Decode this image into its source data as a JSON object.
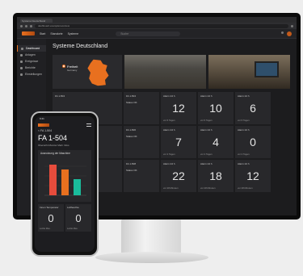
{
  "browser": {
    "tab_title": "Systeme Deutschland",
    "address": "dashboard.example/overview"
  },
  "appbar": {
    "links": [
      "Start",
      "Standorte",
      "Systeme"
    ],
    "search_placeholder": "Suche"
  },
  "sidebar": {
    "items": [
      {
        "label": "Dashboard",
        "active": true
      },
      {
        "label": "Anlagen",
        "active": false
      },
      {
        "label": "Ereignisse",
        "active": false
      },
      {
        "label": "Berichte",
        "active": false
      },
      {
        "label": "Einstellungen",
        "active": false
      }
    ]
  },
  "main": {
    "title": "Systeme Deutschland",
    "map": {
      "location": "Freiheit",
      "region": "Germany"
    }
  },
  "grid": {
    "rows": [
      {
        "left_label": "FA 1-504",
        "info": {
          "head": "FA 1-504",
          "line1": "Status OK"
        },
        "tiles": [
          {
            "head": "Alarm 24 h",
            "value": "12",
            "foot": "vor 6 Tagen"
          },
          {
            "head": "Alarm 24 h",
            "value": "10",
            "foot": "vor 6 Tagen"
          },
          {
            "head": "Alarm 24 h",
            "value": "6",
            "foot": "vor 6 Tagen"
          }
        ]
      },
      {
        "left_label": "FA 1-506",
        "info": {
          "head": "FA 1-506",
          "line1": "Status OK"
        },
        "tiles": [
          {
            "head": "Alarm 24 h",
            "value": "7",
            "foot": "vor 2 Tagen"
          },
          {
            "head": "Alarm 24 h",
            "value": "4",
            "foot": "vor 2 Tagen"
          },
          {
            "head": "Alarm 24 h",
            "value": "0",
            "foot": "vor 2 Tagen"
          }
        ]
      },
      {
        "left_label": "FA 1-508",
        "info": {
          "head": "FA 1-508",
          "line1": "Status OK"
        },
        "tiles": [
          {
            "head": "Alarm 24 h",
            "value": "22",
            "foot": "vor 28 Minuten"
          },
          {
            "head": "Alarm 24 h",
            "value": "18",
            "foot": "vor 28 Minuten"
          },
          {
            "head": "Alarm 24 h",
            "value": "12",
            "foot": "vor 28 Minuten"
          }
        ]
      }
    ]
  },
  "phone": {
    "status_time": "9:41",
    "back_label": "< FA 1-504",
    "title": "FA 1-504",
    "meta": "Übersicht  Monitor  Mehr Infos",
    "chart_title": "Ausnutzung der Maschine",
    "tiles": [
      {
        "head": "Innen Temperatur",
        "value": "0",
        "foot": "Letzte Mes."
      },
      {
        "head": "Luftfeuchte",
        "value": "0",
        "foot": "Letzte Mes."
      }
    ]
  },
  "colors": {
    "accent": "#e8701f",
    "bar_red": "#e74c3c",
    "bar_orange": "#e8701f",
    "bar_teal": "#1abc9c"
  }
}
